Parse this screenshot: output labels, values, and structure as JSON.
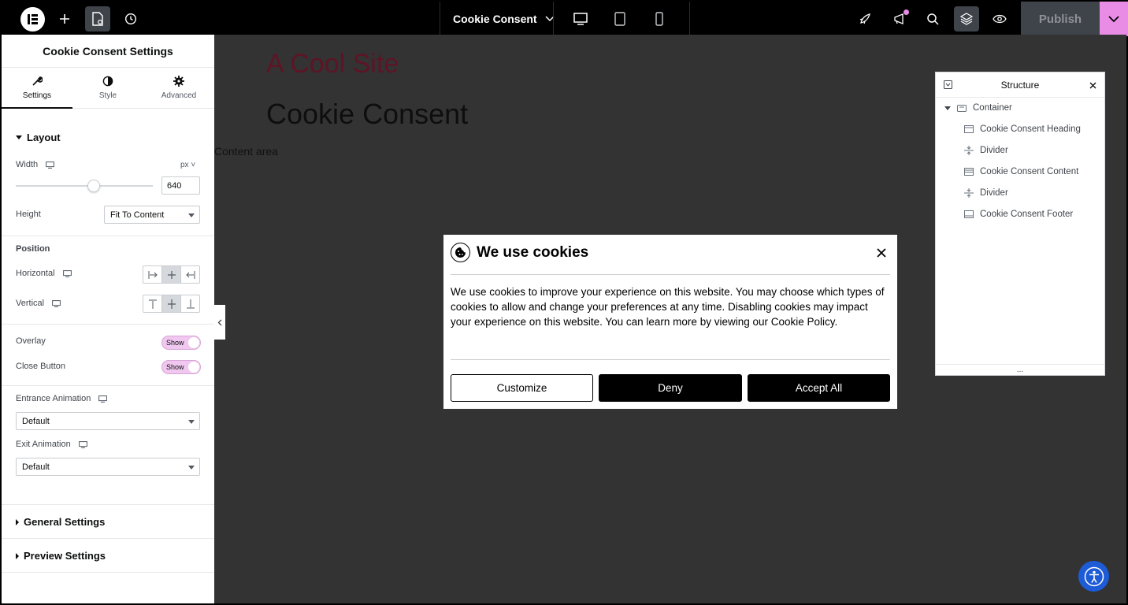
{
  "topbar": {
    "document_title": "Cookie Consent",
    "publish_label": "Publish",
    "colors": {
      "accent": "#e88ce6",
      "bar": "#000000"
    },
    "icons": [
      "elementor-logo-icon",
      "add-icon",
      "page-settings-icon",
      "history-icon",
      "desktop-icon",
      "tablet-icon",
      "mobile-icon",
      "rocket-icon",
      "megaphone-icon",
      "search-icon",
      "layers-icon",
      "eye-icon",
      "chevron-down-icon"
    ]
  },
  "panel": {
    "title": "Cookie Consent Settings",
    "tabs": [
      {
        "label": "Settings",
        "icon": "wrench-icon"
      },
      {
        "label": "Style",
        "icon": "half-circle-icon"
      },
      {
        "label": "Advanced",
        "icon": "gear-icon"
      }
    ],
    "layout": {
      "heading": "Layout",
      "width_label": "Width",
      "width_unit": "px",
      "width_value": "640",
      "width_slider_fraction": 0.57,
      "height_label": "Height",
      "height_value": "Fit To Content",
      "position_heading": "Position",
      "horizontal_label": "Horizontal",
      "vertical_label": "Vertical",
      "overlay_label": "Overlay",
      "overlay_toggle": "Show",
      "close_button_label": "Close Button",
      "close_button_toggle": "Show",
      "entrance_label": "Entrance Animation",
      "entrance_value": "Default",
      "exit_label": "Exit Animation",
      "exit_value": "Default"
    },
    "general_settings": "General Settings",
    "preview_settings": "Preview Settings"
  },
  "canvas": {
    "site_title": "A Cool Site",
    "page_heading": "Cookie Consent",
    "content_area": "Content area",
    "colors": {
      "background": "#333333",
      "site_title": "#5e1426"
    }
  },
  "popup": {
    "title": "We use cookies",
    "body": "We use cookies to improve your experience on this website. You may choose which types of cookies to allow and change your preferences at any time. Disabling cookies may impact your experience on this website. You can learn more by viewing our Cookie Policy.",
    "buttons": {
      "customize": "Customize",
      "deny": "Deny",
      "accept": "Accept All"
    }
  },
  "structure": {
    "title": "Structure",
    "items": [
      {
        "label": "Container",
        "icon": "container-icon"
      },
      {
        "label": "Cookie Consent Heading",
        "icon": "heading-widget-icon"
      },
      {
        "label": "Divider",
        "icon": "divider-icon"
      },
      {
        "label": "Cookie Consent Content",
        "icon": "text-widget-icon"
      },
      {
        "label": "Divider",
        "icon": "divider-icon"
      },
      {
        "label": "Cookie Consent Footer",
        "icon": "footer-widget-icon"
      }
    ],
    "footer": "..."
  }
}
